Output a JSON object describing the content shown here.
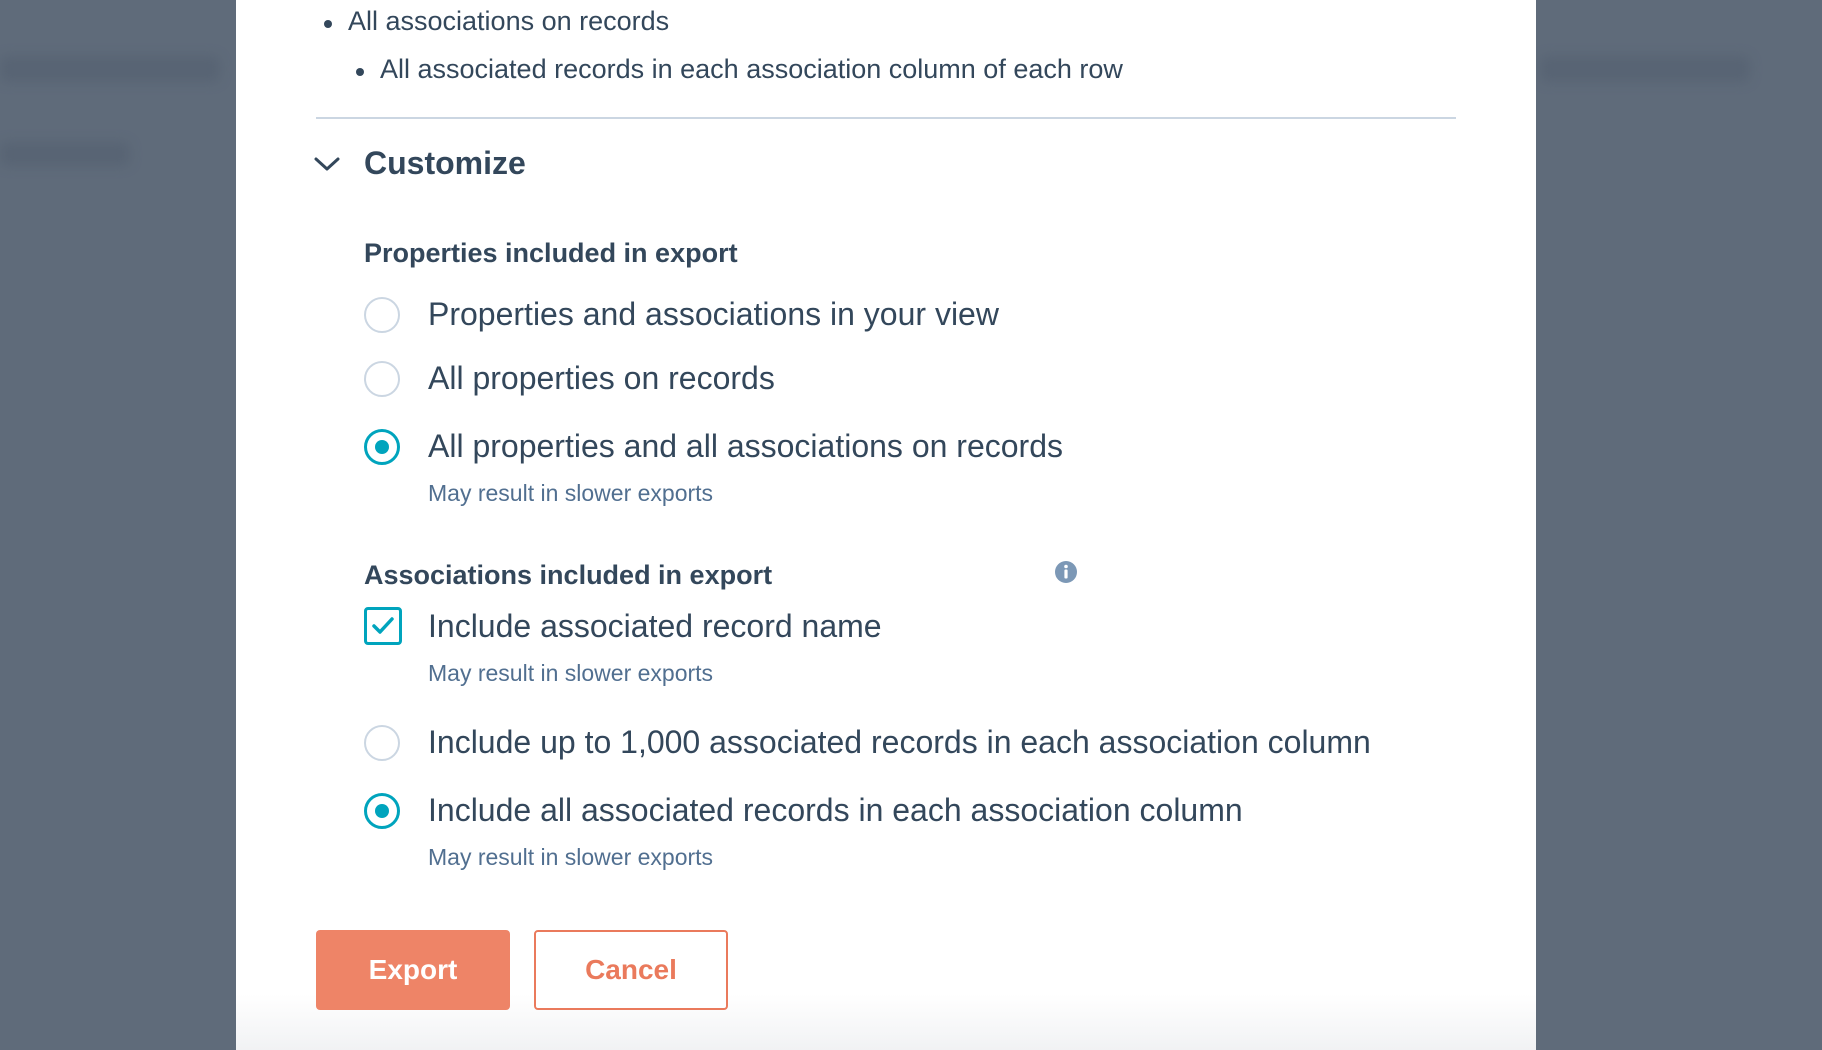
{
  "background": {
    "overlay_color": "#5f6b7a"
  },
  "modal": {
    "bullets": [
      "All associations on records",
      "All associated records in each association column of each row"
    ],
    "customize": {
      "title": "Customize",
      "expanded": true,
      "chevron_icon": "chevron-down-icon"
    },
    "properties_section": {
      "heading": "Properties included in export",
      "options": [
        {
          "label": "Properties and associations in your view",
          "selected": false
        },
        {
          "label": "All properties on records",
          "selected": false
        },
        {
          "label": "All properties and all associations on records",
          "selected": true,
          "help": "May result in slower exports"
        }
      ]
    },
    "associations_section": {
      "heading": "Associations included in export",
      "info_icon": "info-icon",
      "checkbox": {
        "label": "Include associated record name",
        "checked": true,
        "help": "May result in slower exports"
      },
      "options": [
        {
          "label": "Include up to 1,000 associated records in each association column",
          "selected": false
        },
        {
          "label": "Include all associated records in each association column",
          "selected": true,
          "help": "May result in slower exports"
        }
      ]
    },
    "actions": {
      "export_label": "Export",
      "cancel_label": "Cancel"
    }
  },
  "colors": {
    "accent": "#00a4bd",
    "primary_button": "#ee8467",
    "text": "#33475b",
    "help_text": "#516f90"
  }
}
